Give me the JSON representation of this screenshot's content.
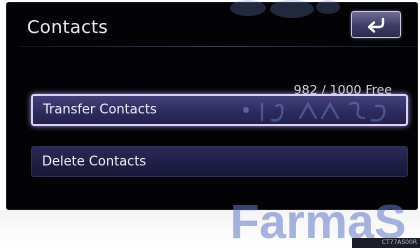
{
  "header": {
    "title": "Contacts",
    "back_icon": "back-arrow-icon"
  },
  "main": {
    "capacity": "982 / 1000 Free",
    "transfer_label": "Transfer Contacts",
    "delete_label": "Delete Contacts"
  },
  "watermark": {
    "brand": "FarmaS"
  },
  "footer": {
    "code": "CT77AS00R"
  },
  "colors": {
    "screen_bg": "#030306",
    "button_bg": "#2c2a5c",
    "highlight_border": "#d9d2f8",
    "watermark_blue": "#6e8cd2"
  }
}
